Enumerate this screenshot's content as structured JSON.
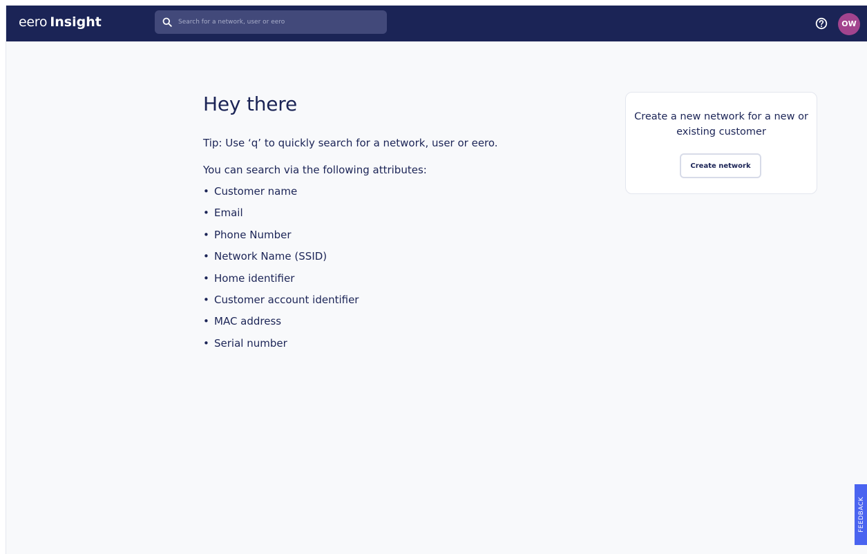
{
  "header": {
    "brand_prefix": "eero",
    "brand_name": "Insight",
    "search_placeholder": "Search for a network, user or eero",
    "avatar_initials": "OW"
  },
  "main": {
    "title": "Hey there",
    "tip": "Tip: Use ‘q’ to quickly search for a network, user or eero.",
    "attributes_intro": "You can search via the following attributes:",
    "attributes": [
      "Customer name",
      "Email",
      "Phone Number",
      "Network Name (SSID)",
      "Home identifier",
      "Customer account identifier",
      "MAC address",
      "Serial number"
    ]
  },
  "card": {
    "text": "Create a new network for a new or existing customer",
    "button_label": "Create network"
  },
  "feedback_label": "FEEDBACK",
  "icons": {
    "search": "search-icon",
    "help": "help-icon"
  },
  "colors": {
    "header_bg": "#1b2456",
    "search_bg": "#42497a",
    "avatar_bg": "#a3448e",
    "feedback_bg": "#4a64f0",
    "page_bg": "#f8f9fb",
    "text_primary": "#1b2456"
  }
}
